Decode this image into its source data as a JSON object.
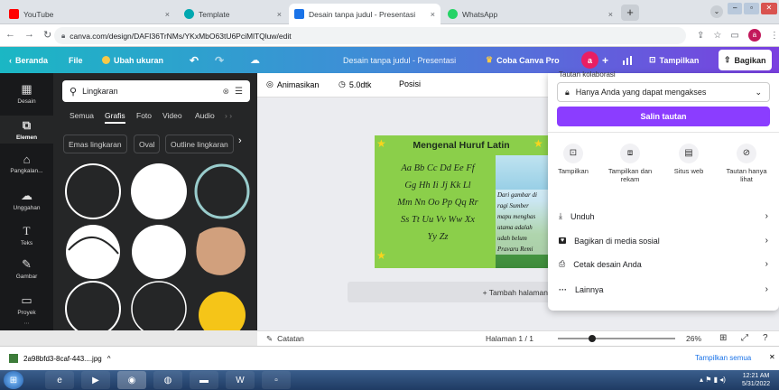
{
  "browser": {
    "tabs": [
      {
        "label": "YouTube",
        "color": "#ff0000"
      },
      {
        "label": "Template",
        "color": "#00a8b0"
      },
      {
        "label": "Desain tanpa judul - Presentasi",
        "color": "#1a73e8"
      },
      {
        "label": "WhatsApp",
        "color": "#25d366"
      }
    ],
    "new_tab": "+",
    "url": "canva.com/design/DAFI36TrNMs/YKxMbO63tU6PciMlTQluw/edit",
    "profile_initial": "a"
  },
  "canva_bar": {
    "home": "Beranda",
    "file": "File",
    "resize": "Ubah ukuran",
    "doc_title": "Desain tanpa judul - Presentasi",
    "pro": "Coba Canva Pro",
    "avatar": "a",
    "present": "Tampilkan",
    "share": "Bagikan"
  },
  "rail": [
    {
      "label": "Desain",
      "icon": "layout-icon"
    },
    {
      "label": "Elemen",
      "icon": "shapes-icon"
    },
    {
      "label": "Pangkalan...",
      "icon": "brand-icon"
    },
    {
      "label": "Unggahan",
      "icon": "cloud-upload-icon"
    },
    {
      "label": "Teks",
      "icon": "text-icon"
    },
    {
      "label": "Gambar",
      "icon": "draw-icon"
    },
    {
      "label": "Proyek",
      "icon": "folder-icon"
    }
  ],
  "panel": {
    "search_value": "Lingkaran",
    "tabs": [
      "Semua",
      "Grafis",
      "Foto",
      "Video",
      "Audio"
    ],
    "chips": [
      "Emas lingkaran",
      "Oval",
      "Outline lingkaran"
    ]
  },
  "toolbar": {
    "animate": "Animasikan",
    "duration": "5.0dtk",
    "position": "Posisi"
  },
  "slide": {
    "title": "Mengenal Huruf Latin",
    "lines": [
      "Aa Bb Cc Dd Ee Ff",
      "Gg Hh Ii Jj Kk Ll",
      "Mm Nn Oo Pp Qq Rr",
      "Ss Tt Uu Vv Ww Xx",
      "Yy Zz"
    ],
    "side_text": [
      "Dari gambar di",
      "ragi Sumber",
      "mapu menghas",
      "utama adalah",
      "udah belum",
      "Pravaru Remi"
    ],
    "add_page": "+ Tambah halaman"
  },
  "share": {
    "collab_label": "Tautan kolaborasi",
    "access": "Hanya Anda yang dapat mengakses",
    "copy_link": "Salin tautan",
    "options": [
      {
        "label": "Tampilkan",
        "icon": "present-icon"
      },
      {
        "label": "Tampilkan dan rekam",
        "icon": "record-icon"
      },
      {
        "label": "Situs web",
        "icon": "website-icon"
      },
      {
        "label": "Tautan hanya lihat",
        "icon": "link-icon"
      }
    ],
    "rows": [
      {
        "label": "Unduh",
        "icon": "download-icon"
      },
      {
        "label": "Bagikan di media sosial",
        "icon": "heart-icon"
      },
      {
        "label": "Cetak desain Anda",
        "icon": "print-icon"
      },
      {
        "label": "Lainnya",
        "icon": "more-icon"
      }
    ]
  },
  "bottom": {
    "notes": "Catatan",
    "page": "Halaman 1 / 1",
    "zoom": "26%",
    "zoom_fraction": 0.26
  },
  "downloads": {
    "file": "2a98bfd3-8caf-443....jpg",
    "show_all": "Tampilkan semua"
  },
  "taskbar": {
    "time": "12:21 AM",
    "date": "5/31/2022"
  },
  "colors": {
    "accent": "#8b3dff",
    "slide_green": "#8bcf4a"
  }
}
